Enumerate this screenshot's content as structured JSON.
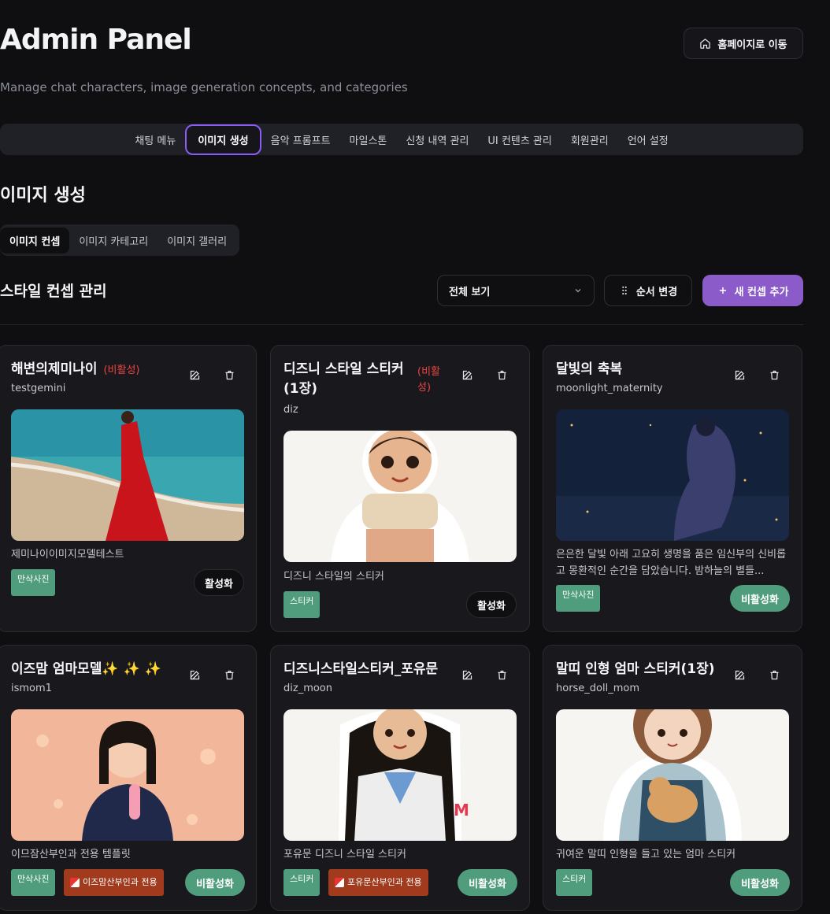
{
  "header": {
    "title": "Admin Panel",
    "subtitle": "Manage chat characters, image generation concepts, and categories",
    "home_button": "홈페이지로 이동"
  },
  "nav": {
    "items": [
      "채팅 메뉴",
      "이미지 생성",
      "음악 프롬프트",
      "마일스톤",
      "신청 내역 관리",
      "UI 컨텐츠 관리",
      "회원관리",
      "언어 설정"
    ],
    "active": "이미지 생성"
  },
  "section": {
    "title": "이미지 생성",
    "subtabs": [
      "이미지 컨셉",
      "이미지 카테고리",
      "이미지 갤러리"
    ],
    "active_subtab": "이미지 컨셉"
  },
  "concepts": {
    "title": "스타일 컨셉 관리",
    "filter_value": "전체 보기",
    "reorder_label": "순서 변경",
    "add_label": "새 컨셉 추가"
  },
  "cards": [
    {
      "title": "해변의제미나이",
      "status_tag": "(비활성)",
      "slug": "testgemini",
      "description": "제미나이이미지모델테스트",
      "category": "만삭사진",
      "action": "활성화"
    },
    {
      "title": "디즈니 스타일 스티커 (1장)",
      "status_tag": "(비활성)",
      "slug": "diz",
      "description": "디즈니 스타일의 스티커",
      "category": "스티커",
      "action": "활성화"
    },
    {
      "title": "달빛의 축복",
      "slug": "moonlight_maternity",
      "description": "은은한 달빛 아래 고요히 생명을 품은 임신부의 신비롭고 몽환적인 순간을 담았습니다. 밤하늘의 별들...",
      "category": "만삭사진",
      "action": "비활성화"
    },
    {
      "title": "이즈맘 엄마모델✨ ✨ ✨",
      "slug": "ismom1",
      "description": "이므잠산부인과 전용 템플릿",
      "category": "만삭사진",
      "hospital": "이즈맘산부인과 전용",
      "action": "비활성화"
    },
    {
      "title": "디즈니스타일스티커_포유문",
      "slug": "diz_moon",
      "description": "포유문 디즈니 스타일 스티커",
      "category": "스티커",
      "hospital": "포유문산부인과 전용",
      "action": "비활성화"
    },
    {
      "title": "말띠 인형 엄마 스티커(1장)",
      "slug": "horse_doll_mom",
      "description": "귀여운 말띠 인형을 들고 있는 엄마 스티커",
      "category": "스티커",
      "action": "비활성화"
    }
  ],
  "colors": {
    "accent": "#8b5cc9",
    "active_border": "#8b5cf6",
    "inactive_red": "#ef4444",
    "badge_green": "#4f9d7d",
    "badge_red": "#a23a1d"
  }
}
